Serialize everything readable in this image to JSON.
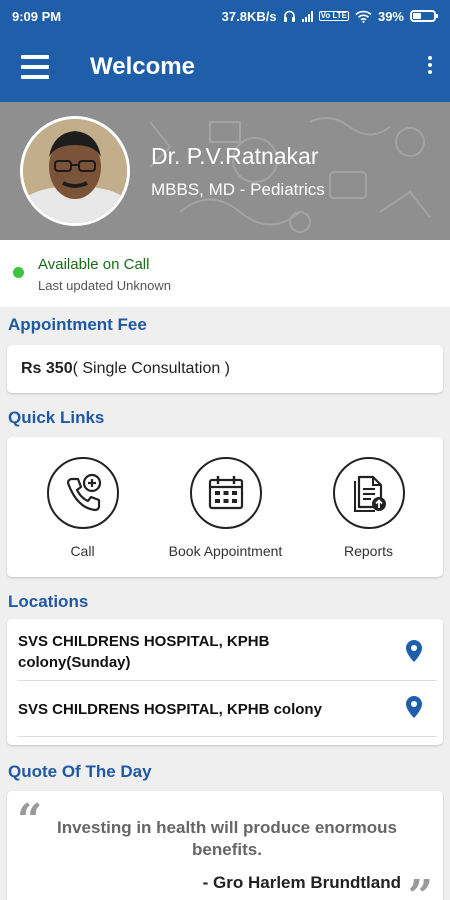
{
  "status_bar": {
    "time": "9:09 PM",
    "speed": "37.8KB/s",
    "volte": "Vo LTE",
    "battery": "39%",
    "battery_level": 0.39
  },
  "app_bar": {
    "title": "Welcome",
    "menu_icon": "hamburger-menu-icon",
    "more_icon": "more-vertical-icon"
  },
  "profile": {
    "name": "Dr. P.V.Ratnakar",
    "qualification": "MBBS, MD - Pediatrics"
  },
  "availability": {
    "status": "Available on Call",
    "updated": "Last updated Unknown",
    "status_color": "#3ec33e"
  },
  "fee": {
    "title": "Appointment Fee",
    "amount": "Rs 350",
    "note": "( Single Consultation )"
  },
  "quick_links": {
    "title": "Quick Links",
    "items": [
      {
        "label": "Call",
        "icon": "phone-plus-icon"
      },
      {
        "label": "Book Appointment",
        "icon": "calendar-icon"
      },
      {
        "label": "Reports",
        "icon": "document-upload-icon"
      }
    ]
  },
  "locations": {
    "title": "Locations",
    "items": [
      {
        "line1": "SVS CHILDRENS HOSPITAL, KPHB",
        "line2": "colony(Sunday)"
      },
      {
        "line1": "SVS CHILDRENS HOSPITAL, KPHB colony",
        "line2": ""
      }
    ]
  },
  "quote": {
    "title": "Quote Of The Day",
    "line1": "Investing in health will produce enormous",
    "line2": "benefits.",
    "author": "- Gro Harlem Brundtland"
  },
  "colors": {
    "primary": "#1f5fa9",
    "section_title": "#2059a3",
    "pin": "#1f5fa9"
  }
}
